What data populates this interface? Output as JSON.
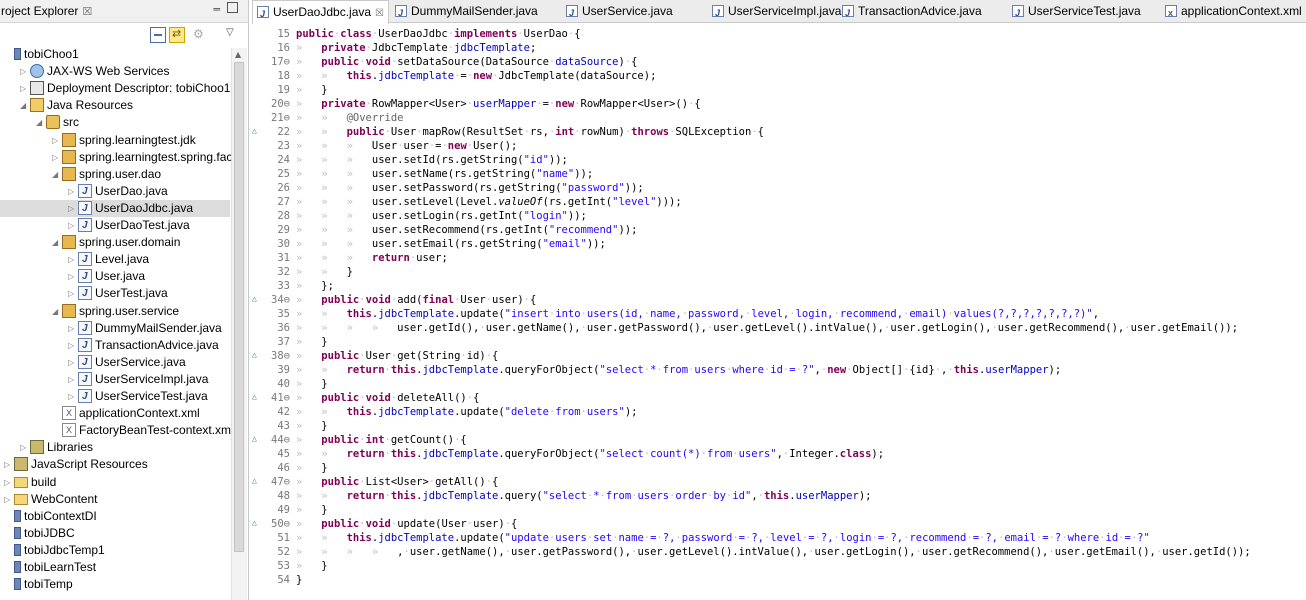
{
  "explorer": {
    "title": "roject Explorer",
    "close_glyph": "☒",
    "min_glyph": "═",
    "tree": [
      {
        "label": "tobiChoo1",
        "icon": "project-icon",
        "indent": 0,
        "twisty": ""
      },
      {
        "label": "JAX-WS Web Services",
        "icon": "web-services-icon",
        "indent": 1,
        "twisty": "▷"
      },
      {
        "label": "Deployment Descriptor: tobiChoo1",
        "icon": "deployment-descriptor-icon",
        "indent": 1,
        "twisty": "▷"
      },
      {
        "label": "Java Resources",
        "icon": "java-resources-icon",
        "indent": 1,
        "twisty": "◢"
      },
      {
        "label": "src",
        "icon": "source-folder-icon",
        "indent": 2,
        "twisty": "◢"
      },
      {
        "label": "spring.learningtest.jdk",
        "icon": "package-icon",
        "indent": 3,
        "twisty": "▷"
      },
      {
        "label": "spring.learningtest.spring.factor",
        "icon": "package-icon",
        "indent": 3,
        "twisty": "▷"
      },
      {
        "label": "spring.user.dao",
        "icon": "package-icon",
        "indent": 3,
        "twisty": "◢"
      },
      {
        "label": "UserDao.java",
        "icon": "java-file-icon",
        "indent": 4,
        "twisty": "▷"
      },
      {
        "label": "UserDaoJdbc.java",
        "icon": "java-file-icon",
        "indent": 4,
        "twisty": "▷",
        "selected": true
      },
      {
        "label": "UserDaoTest.java",
        "icon": "java-file-icon",
        "indent": 4,
        "twisty": "▷"
      },
      {
        "label": "spring.user.domain",
        "icon": "package-icon",
        "indent": 3,
        "twisty": "◢"
      },
      {
        "label": "Level.java",
        "icon": "java-file-icon",
        "indent": 4,
        "twisty": "▷"
      },
      {
        "label": "User.java",
        "icon": "java-file-icon",
        "indent": 4,
        "twisty": "▷"
      },
      {
        "label": "UserTest.java",
        "icon": "java-file-icon",
        "indent": 4,
        "twisty": "▷"
      },
      {
        "label": "spring.user.service",
        "icon": "package-icon",
        "indent": 3,
        "twisty": "◢"
      },
      {
        "label": "DummyMailSender.java",
        "icon": "java-file-icon",
        "indent": 4,
        "twisty": "▷"
      },
      {
        "label": "TransactionAdvice.java",
        "icon": "java-file-icon",
        "indent": 4,
        "twisty": "▷"
      },
      {
        "label": "UserService.java",
        "icon": "java-file-icon",
        "indent": 4,
        "twisty": "▷"
      },
      {
        "label": "UserServiceImpl.java",
        "icon": "java-file-icon",
        "indent": 4,
        "twisty": "▷"
      },
      {
        "label": "UserServiceTest.java",
        "icon": "java-file-icon",
        "indent": 4,
        "twisty": "▷"
      },
      {
        "label": "applicationContext.xml",
        "icon": "xml-file-icon",
        "indent": 3,
        "twisty": ""
      },
      {
        "label": "FactoryBeanTest-context.xml",
        "icon": "xml-file-icon",
        "indent": 3,
        "twisty": ""
      },
      {
        "label": "Libraries",
        "icon": "libraries-icon",
        "indent": 1,
        "twisty": "▷"
      },
      {
        "label": "JavaScript Resources",
        "icon": "libraries-icon",
        "indent": 0,
        "twisty": "▷"
      },
      {
        "label": "build",
        "icon": "folder-icon",
        "indent": 0,
        "twisty": "▷"
      },
      {
        "label": "WebContent",
        "icon": "folder-icon",
        "indent": 0,
        "twisty": "▷"
      },
      {
        "label": "tobiContextDI",
        "icon": "project-icon",
        "indent": 0,
        "twisty": ""
      },
      {
        "label": "tobiJDBC",
        "icon": "project-icon",
        "indent": 0,
        "twisty": ""
      },
      {
        "label": "tobiJdbcTemp1",
        "icon": "project-icon",
        "indent": 0,
        "twisty": ""
      },
      {
        "label": "tobiLearnTest",
        "icon": "project-icon",
        "indent": 0,
        "twisty": ""
      },
      {
        "label": "tobiTemp",
        "icon": "project-icon",
        "indent": 0,
        "twisty": ""
      }
    ]
  },
  "editor": {
    "tabs": [
      {
        "label": "UserDaoJdbc.java",
        "active": true,
        "icon": "java-file-icon"
      },
      {
        "label": "DummyMailSender.java",
        "active": false,
        "icon": "java-file-icon"
      },
      {
        "label": "UserService.java",
        "active": false,
        "icon": "java-file-icon"
      },
      {
        "label": "UserServiceImpl.java",
        "active": false,
        "icon": "java-file-icon"
      },
      {
        "label": "TransactionAdvice.java",
        "active": false,
        "icon": "java-file-icon"
      },
      {
        "label": "UserServiceTest.java",
        "active": false,
        "icon": "java-file-icon"
      },
      {
        "label": "applicationContext.xml",
        "active": false,
        "icon": "xml-file-icon"
      }
    ],
    "tab_close_glyph": "☒",
    "lines": [
      {
        "n": "15",
        "m": "",
        "code": "[k]public[/k]·[k]class[/k]·UserDaoJdbc·[k]implements[/k]·UserDao·{"
      },
      {
        "n": "16",
        "m": "",
        "code": "»   [k]private[/k]·JdbcTemplate·[f]jdbcTemplate[/f];"
      },
      {
        "n": "17",
        "m": "⊖",
        "code": "»   [k]public[/k]·[k]void[/k]·setDataSource(DataSource·[f]dataSource[/f])·{"
      },
      {
        "n": "18",
        "m": "",
        "code": "»   »   [k]this[/k].[f]jdbcTemplate[/f]·=·[k]new[/k]·JdbcTemplate(dataSource);"
      },
      {
        "n": "19",
        "m": "",
        "code": "»   }"
      },
      {
        "n": "20",
        "m": "⊖",
        "code": "»   [k]private[/k]·RowMapper<User>·[f]userMapper[/f]·=·[k]new[/k]·RowMapper<User>()·{"
      },
      {
        "n": "21",
        "m": "⊖",
        "code": "»   »   [a]@Override[/a]"
      },
      {
        "n": "22",
        "m": "△",
        "code": "»   »   [k]public[/k]·User·mapRow(ResultSet·rs,·[k]int[/k]·rowNum)·[k]throws[/k]·SQLException·{"
      },
      {
        "n": "23",
        "m": "",
        "code": "»   »   »   User·user·=·[k]new[/k]·User();"
      },
      {
        "n": "24",
        "m": "",
        "code": "»   »   »   user.setId(rs.getString([s]\"id\"[/s]));"
      },
      {
        "n": "25",
        "m": "",
        "code": "»   »   »   user.setName(rs.getString([s]\"name\"[/s]));"
      },
      {
        "n": "26",
        "m": "",
        "code": "»   »   »   user.setPassword(rs.getString([s]\"password\"[/s]));"
      },
      {
        "n": "27",
        "m": "",
        "code": "»   »   »   user.setLevel(Level.[i]valueOf[/i](rs.getInt([s]\"level\"[/s])));"
      },
      {
        "n": "28",
        "m": "",
        "code": "»   »   »   user.setLogin(rs.getInt([s]\"login\"[/s]));"
      },
      {
        "n": "29",
        "m": "",
        "code": "»   »   »   user.setRecommend(rs.getInt([s]\"recommend\"[/s]));"
      },
      {
        "n": "30",
        "m": "",
        "code": "»   »   »   user.setEmail(rs.getString([s]\"email\"[/s]));"
      },
      {
        "n": "31",
        "m": "",
        "code": "»   »   »   [k]return[/k]·user;"
      },
      {
        "n": "32",
        "m": "",
        "code": "»   »   }"
      },
      {
        "n": "33",
        "m": "",
        "code": "»   };"
      },
      {
        "n": "34",
        "m": "△⊖",
        "code": "»   [k]public[/k]·[k]void[/k]·add([k]final[/k]·User·user)·{"
      },
      {
        "n": "35",
        "m": "",
        "code": "»   »   [k]this[/k].[f]jdbcTemplate[/f].update([s]\"insert·into·users(id,·name,·password,·level,·login,·recommend,·email)·values(?,?,?,?,?,?,?)\"[/s],"
      },
      {
        "n": "36",
        "m": "",
        "code": "»   »   »   »   user.getId(),·user.getName(),·user.getPassword(),·user.getLevel().intValue(),·user.getLogin(),·user.getRecommend(),·user.getEmail());"
      },
      {
        "n": "37",
        "m": "",
        "code": "»   }"
      },
      {
        "n": "38",
        "m": "△⊖",
        "code": "»   [k]public[/k]·User·get(String·id)·{"
      },
      {
        "n": "39",
        "m": "",
        "code": "»   »   [k]return[/k]·[k]this[/k].[f]jdbcTemplate[/f].queryForObject([s]\"select·*·from·users·where·id·=·?\"[/s],·[k]new[/k]·Object[]·{id}·,·[k]this[/k].[f]userMapper[/f]);"
      },
      {
        "n": "40",
        "m": "",
        "code": "»   }"
      },
      {
        "n": "41",
        "m": "△⊖",
        "code": "»   [k]public[/k]·[k]void[/k]·deleteAll()·{"
      },
      {
        "n": "42",
        "m": "",
        "code": "»   »   [k]this[/k].[f]jdbcTemplate[/f].update([s]\"delete·from·users\"[/s]);"
      },
      {
        "n": "43",
        "m": "",
        "code": "»   }"
      },
      {
        "n": "44",
        "m": "△⊖",
        "code": "»   [k]public[/k]·[k]int[/k]·getCount()·{"
      },
      {
        "n": "45",
        "m": "",
        "code": "»   »   [k]return[/k]·[k]this[/k].[f]jdbcTemplate[/f].queryForObject([s]\"select·count(*)·from·users\"[/s],·Integer.[k]class[/k]);"
      },
      {
        "n": "46",
        "m": "",
        "code": "»   }"
      },
      {
        "n": "47",
        "m": "△⊖",
        "code": "»   [k]public[/k]·List<User>·getAll()·{"
      },
      {
        "n": "48",
        "m": "",
        "code": "»   »   [k]return[/k]·[k]this[/k].[f]jdbcTemplate[/f].query([s]\"select·*·from·users·order·by·id\"[/s],·[k]this[/k].[f]userMapper[/f]);"
      },
      {
        "n": "49",
        "m": "",
        "code": "»   }"
      },
      {
        "n": "50",
        "m": "△⊖",
        "code": "»   [k]public[/k]·[k]void[/k]·update(User·user)·{"
      },
      {
        "n": "51",
        "m": "",
        "code": "»   »   [k]this[/k].[f]jdbcTemplate[/f].update([s]\"update·users·set·name·=·?,·password·=·?,·level·=·?,·login·=·?,·recommend·=·?,·email·=·?·where·id·=·?\"[/s]"
      },
      {
        "n": "52",
        "m": "",
        "code": "»   »   »   »   ,·user.getName(),·user.getPassword(),·user.getLevel().intValue(),·user.getLogin(),·user.getRecommend(),·user.getEmail(),·user.getId());"
      },
      {
        "n": "53",
        "m": "",
        "code": "»   }"
      },
      {
        "n": "54",
        "m": "",
        "code": "}"
      }
    ]
  }
}
